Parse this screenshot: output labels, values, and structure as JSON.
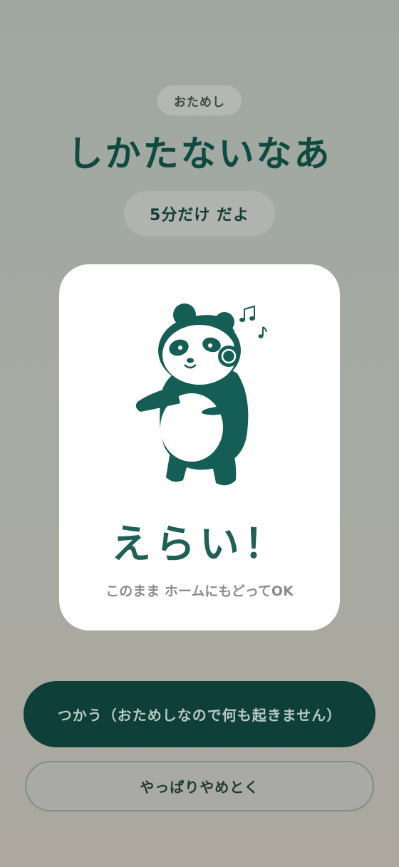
{
  "header": {
    "badge_label": "おためし",
    "title": "しかたないなあ",
    "duration_label": "5分だけ だよ"
  },
  "card": {
    "illustration_icon": "panda-with-headphones-icon",
    "headline": "えらい！",
    "message": "このまま ホームにもどってOK"
  },
  "actions": {
    "use_label": "つかう（おためしなので何も起きません）",
    "cancel_label": "やっぱりやめとく"
  },
  "colors": {
    "accent": "#0f3f39",
    "panda": "#155e55",
    "title": "#0f4a40"
  }
}
